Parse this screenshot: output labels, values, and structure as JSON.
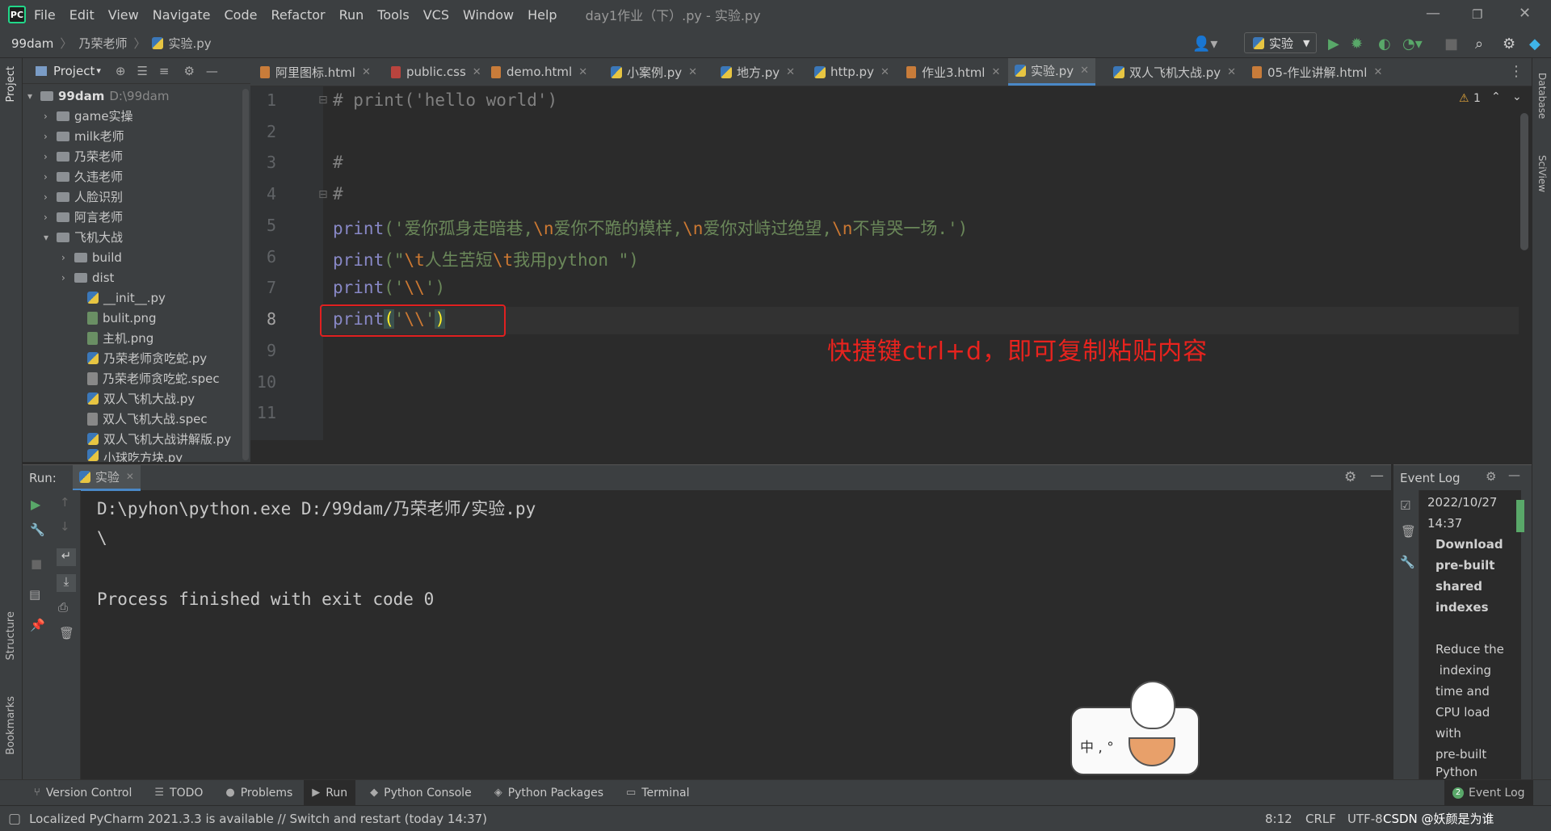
{
  "menubar": {
    "logo_text": "PC",
    "items": [
      "File",
      "Edit",
      "View",
      "Navigate",
      "Code",
      "Refactor",
      "Run",
      "Tools",
      "VCS",
      "Window",
      "Help"
    ],
    "window_title": "day1作业（下）.py - 实验.py"
  },
  "navbar": {
    "crumbs": [
      "99dam",
      "乃荣老师",
      "实验.py"
    ],
    "run_config": "实验"
  },
  "left_strip": {
    "project": "Project",
    "structure": "Structure",
    "bookmarks": "Bookmarks"
  },
  "right_strip": {
    "database": "Database",
    "sciview": "SciView"
  },
  "project_panel": {
    "title": "Project",
    "root_name": "99dam",
    "root_path": "D:\\99dam",
    "items": [
      {
        "label": "game实操",
        "kind": "folder"
      },
      {
        "label": "milk老师",
        "kind": "folder"
      },
      {
        "label": "乃荣老师",
        "kind": "folder"
      },
      {
        "label": "久违老师",
        "kind": "folder"
      },
      {
        "label": "人脸识别",
        "kind": "folder"
      },
      {
        "label": "阿言老师",
        "kind": "folder"
      },
      {
        "label": "飞机大战",
        "kind": "folder"
      },
      {
        "label": "build",
        "kind": "folder"
      },
      {
        "label": "dist",
        "kind": "folder"
      },
      {
        "label": "__init__.py",
        "kind": "py"
      },
      {
        "label": "bulit.png",
        "kind": "file"
      },
      {
        "label": "主机.png",
        "kind": "file"
      },
      {
        "label": "乃荣老师贪吃蛇.py",
        "kind": "py"
      },
      {
        "label": "乃荣老师贪吃蛇.spec",
        "kind": "file"
      },
      {
        "label": "双人飞机大战.py",
        "kind": "py"
      },
      {
        "label": "双人飞机大战.spec",
        "kind": "file"
      },
      {
        "label": "双人飞机大战讲解版.py",
        "kind": "py"
      },
      {
        "label": "小球吃方块.py",
        "kind": "py"
      }
    ]
  },
  "tabs": [
    {
      "label": "阿里图标.html"
    },
    {
      "label": "public.css"
    },
    {
      "label": "demo.html"
    },
    {
      "label": "小案例.py"
    },
    {
      "label": "地方.py"
    },
    {
      "label": "http.py"
    },
    {
      "label": "作业3.html"
    },
    {
      "label": "实验.py"
    },
    {
      "label": "双人飞机大战.py"
    },
    {
      "label": "05-作业讲解.html"
    }
  ],
  "editor": {
    "warning_count": "1",
    "line_numbers": [
      "1",
      "2",
      "3",
      "4",
      "5",
      "6",
      "7",
      "8",
      "9",
      "10",
      "11"
    ],
    "line1": "# print('hello world')",
    "line3": "#",
    "line4": "#",
    "l5_fn": "print",
    "l5_open": "('",
    "l5_s1": "爱你孤身走暗巷,",
    "l5_s2": "爱你不跪的模样,",
    "l5_s3": "爱你对峙过绝望,",
    "l5_s4": "不肯哭一场.",
    "l5_close": "')",
    "escape_n": "\\n",
    "escape_t": "\\t",
    "l6_fn": "print",
    "l6_open": "(\"",
    "l6_s1": "人生苦短",
    "l6_s2": "我用python ",
    "l6_close": "\")",
    "l7_fn": "print",
    "l7_open": "('",
    "l7_esc": "\\\\",
    "l7_close": "')",
    "l8_fn": "print",
    "l8_p1": "(",
    "l8_q1": "'",
    "l8_esc": "\\\\",
    "l8_q2": "'",
    "l8_p2": ")"
  },
  "annotation": "快捷键ctrl+d，即可复制粘贴内容",
  "run_panel": {
    "label": "Run:",
    "tab": "实验",
    "output": [
      "D:\\pyhon\\python.exe D:/99dam/乃荣老师/实验.py",
      "\\",
      "",
      "Process finished with exit code 0"
    ]
  },
  "event_log": {
    "title": "Event Log",
    "date": "2022/10/27",
    "time": "14:37",
    "heading_lines": [
      "Download",
      "pre-built",
      "shared",
      "indexes"
    ],
    "body_lines": [
      "Reduce the",
      " indexing",
      "time and",
      "CPU load",
      "with",
      "pre-built",
      "Python"
    ]
  },
  "sticker_text": "中 , °",
  "bottom_tools": [
    {
      "label": "Version Control",
      "icon": "⑂"
    },
    {
      "label": "TODO",
      "icon": "☰"
    },
    {
      "label": "Problems",
      "icon": "●"
    },
    {
      "label": "Run",
      "icon": "▶"
    },
    {
      "label": "Python Console",
      "icon": "◆"
    },
    {
      "label": "Python Packages",
      "icon": "◈"
    },
    {
      "label": "Terminal",
      "icon": "▭"
    }
  ],
  "event_log_button": {
    "badge": "2",
    "label": "Event Log"
  },
  "statusbar": {
    "message": "Localized PyCharm 2021.3.3 is available // Switch and restart (today 14:37)",
    "position": "8:12",
    "line_sep": "CRLF",
    "encoding": "UTF-8",
    "watermark": "CSDN @妖颜是为谁"
  },
  "colors": {
    "accent": "#4a88c7",
    "annotation": "#e8231e",
    "run_green": "#59a869"
  }
}
